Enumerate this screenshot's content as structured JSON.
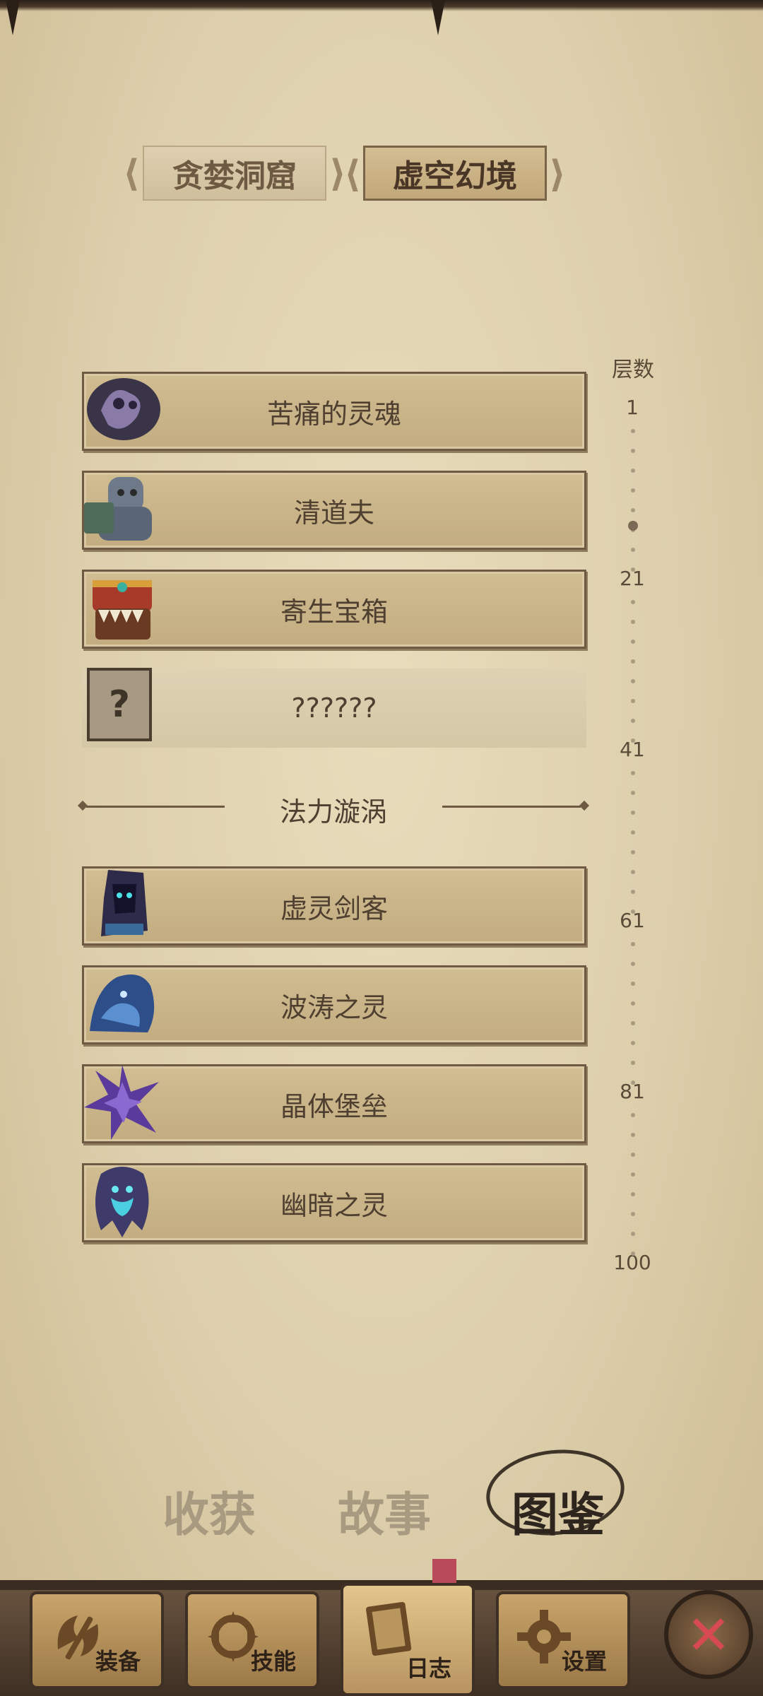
{
  "region_tabs": [
    {
      "label": "贪婪洞窟",
      "active": false
    },
    {
      "label": "虚空幻境",
      "active": true
    }
  ],
  "floors": {
    "title": "层数",
    "marks": [
      "1",
      "21",
      "41",
      "61",
      "81",
      "100"
    ]
  },
  "monsters": [
    {
      "name": "苦痛的灵魂",
      "icon": "tormented-soul-icon"
    },
    {
      "name": "清道夫",
      "icon": "scavenger-icon"
    },
    {
      "name": "寄生宝箱",
      "icon": "parasite-chest-icon"
    },
    {
      "name": "??????",
      "icon": "unknown-question-icon"
    }
  ],
  "section": {
    "title": "法力漩涡"
  },
  "monsters2": [
    {
      "name": "虚灵剑客",
      "icon": "void-swordsman-icon"
    },
    {
      "name": "波涛之灵",
      "icon": "wave-spirit-icon"
    },
    {
      "name": "晶体堡垒",
      "icon": "crystal-fortress-icon"
    },
    {
      "name": "幽暗之灵",
      "icon": "dark-spirit-icon"
    }
  ],
  "bottom_tabs": [
    {
      "label": "收获",
      "active": false
    },
    {
      "label": "故事",
      "active": false
    },
    {
      "label": "图鉴",
      "active": true
    }
  ],
  "nav": [
    {
      "label": "装备",
      "icon": "equipment-axe-icon"
    },
    {
      "label": "技能",
      "icon": "skill-emblem-icon"
    },
    {
      "label": "日志",
      "icon": "journal-book-icon",
      "active": true
    },
    {
      "label": "设置",
      "icon": "settings-gear-icon"
    }
  ],
  "close": {
    "icon": "close-x-icon"
  },
  "colors": {
    "parchment": "#e3d6b6",
    "ink": "#4e3f30",
    "accent_red": "#d84a52"
  }
}
